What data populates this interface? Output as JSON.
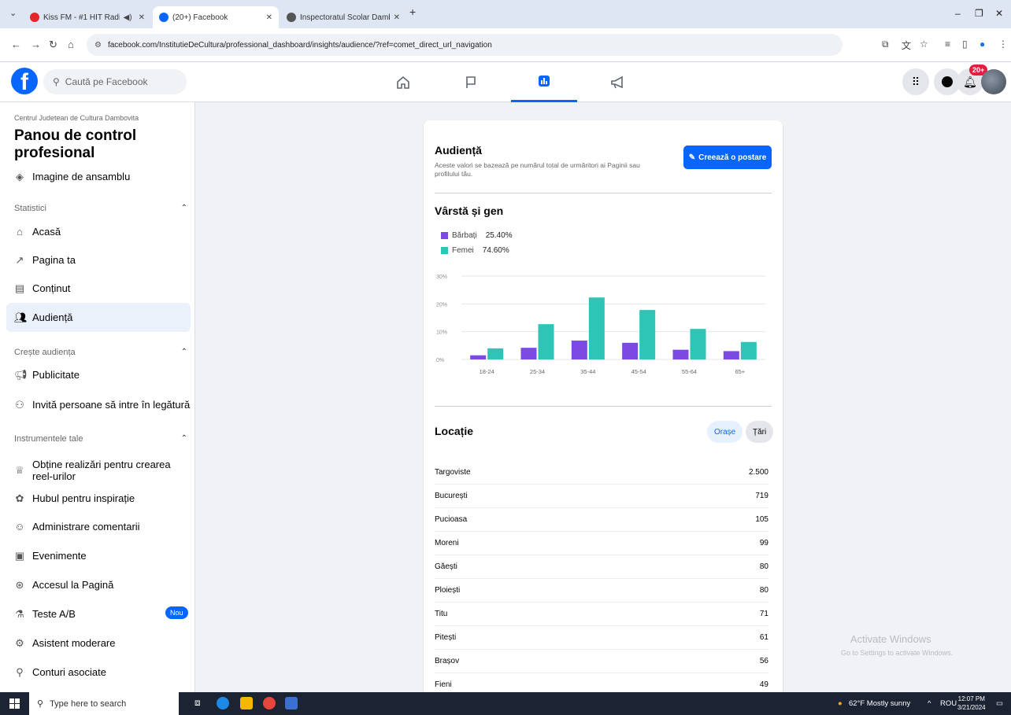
{
  "browser": {
    "tabs": [
      {
        "title": "Kiss FM - #1 HIT Radio",
        "favicon_color": "#e4262b"
      },
      {
        "title": "(20+) Facebook",
        "favicon_color": "#0866ff"
      },
      {
        "title": "Inspectoratul Scolar Dambovita",
        "favicon_color": "#555555"
      }
    ],
    "url": "facebook.com/InstitutieDeCultura/professional_dashboard/insights/audience/?ref=comet_direct_url_navigation"
  },
  "fb_header": {
    "search_placeholder": "Caută pe Facebook",
    "notif_count": "20+"
  },
  "sidebar": {
    "org_name": "Centrul Judetean de Cultura Dambovita",
    "page_title": "Panou de control profesional",
    "overview": "Imagine de ansamblu",
    "section_statistici": "Statistici",
    "item_acasa": "Acasă",
    "item_pagina": "Pagina ta",
    "item_continut": "Conținut",
    "item_audienta": "Audiență",
    "section_creste": "Crește audiența",
    "item_publicitate": "Publicitate",
    "item_invita": "Invită persoane să intre în legătură",
    "section_instrumente": "Instrumentele tale",
    "item_realizari": "Obține realizări pentru crearea reel-urilor",
    "item_hubul": "Hubul pentru inspirație",
    "item_comentarii": "Administrare comentarii",
    "item_evenimente": "Evenimente",
    "item_accesul": "Accesul la Pagină",
    "item_teste": "Teste A/B",
    "nou_badge": "Nou",
    "item_asistent": "Asistent moderare",
    "item_conturi": "Conturi asociate"
  },
  "main": {
    "audience_title": "Audiență",
    "audience_desc": "Aceste valori se bazează pe numărul total de urmăritori ai Paginii sau profilului tău.",
    "create_post": "Creează o postare",
    "age_gender_title": "Vârstă și gen",
    "legend_men": "Bărbați",
    "legend_men_pct": "25.40%",
    "legend_women": "Femei",
    "legend_women_pct": "74.60%",
    "location_title": "Locație",
    "btn_cities": "Orașe",
    "btn_countries": "Țări",
    "locations": [
      {
        "city": "Targoviste",
        "count": "2.500"
      },
      {
        "city": "București",
        "count": "719"
      },
      {
        "city": "Pucioasa",
        "count": "105"
      },
      {
        "city": "Moreni",
        "count": "99"
      },
      {
        "city": "Găești",
        "count": "80"
      },
      {
        "city": "Ploiești",
        "count": "80"
      },
      {
        "city": "Titu",
        "count": "71"
      },
      {
        "city": "Pitești",
        "count": "61"
      },
      {
        "city": "Brașov",
        "count": "56"
      },
      {
        "city": "Fieni",
        "count": "49"
      }
    ]
  },
  "chart_data": {
    "type": "bar",
    "categories": [
      "18-24",
      "25-34",
      "35-44",
      "45-54",
      "55-64",
      "65+"
    ],
    "series": [
      {
        "name": "Bărbați",
        "color": "#7b4ae2",
        "values": [
          1.5,
          4.2,
          6.8,
          6.0,
          3.5,
          3.0
        ]
      },
      {
        "name": "Femei",
        "color": "#2ec4b6",
        "values": [
          4.0,
          12.7,
          22.3,
          17.8,
          11.0,
          6.3
        ]
      }
    ],
    "yticks": [
      "30%",
      "20%",
      "10%",
      "0%"
    ],
    "ylim": [
      0,
      30
    ],
    "grid": true
  },
  "watermark": {
    "line1": "Activate Windows",
    "line2": "Go to Settings to activate Windows."
  },
  "taskbar": {
    "search_placeholder": "Type here to search",
    "weather": "62°F  Mostly sunny",
    "lang": "ROU",
    "time": "12:07 PM",
    "date": "3/21/2024"
  }
}
